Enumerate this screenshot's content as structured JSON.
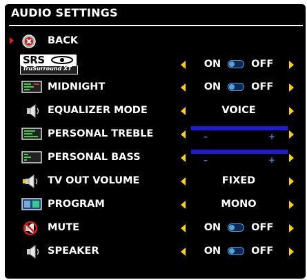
{
  "title": "AUDIO SETTINGS",
  "rows": [
    {
      "label": "BACK",
      "icon": "back-icon"
    },
    {
      "label": "",
      "icon": "srs-trusurround-logo",
      "logo_text": "SRS",
      "logo_sub": "TruSurround XT",
      "on": "ON",
      "off": "OFF"
    },
    {
      "label": "MIDNIGHT",
      "icon": "midnight-icon",
      "on": "ON",
      "off": "OFF"
    },
    {
      "label": "EQUALIZER MODE",
      "icon": "speaker-icon",
      "value": "VOICE"
    },
    {
      "label": "PERSONAL TREBLE",
      "icon": "treble-icon",
      "minus": "–",
      "plus": "+"
    },
    {
      "label": "PERSONAL BASS",
      "icon": "bass-icon",
      "minus": "–",
      "plus": "+"
    },
    {
      "label": "TV OUT VOLUME",
      "icon": "tv-out-volume-icon",
      "value": "FIXED"
    },
    {
      "label": "PROGRAM",
      "icon": "program-icon",
      "value": "MONO"
    },
    {
      "label": "MUTE",
      "icon": "mute-icon",
      "on": "ON",
      "off": "OFF"
    },
    {
      "label": "SPEAKER",
      "icon": "speaker-icon",
      "on": "ON",
      "off": "OFF"
    }
  ],
  "colors": {
    "arrow": "#ffd100",
    "slider": "#1b1bd8",
    "toggle": "#5aa0d8",
    "pointer": "#e0201a"
  }
}
